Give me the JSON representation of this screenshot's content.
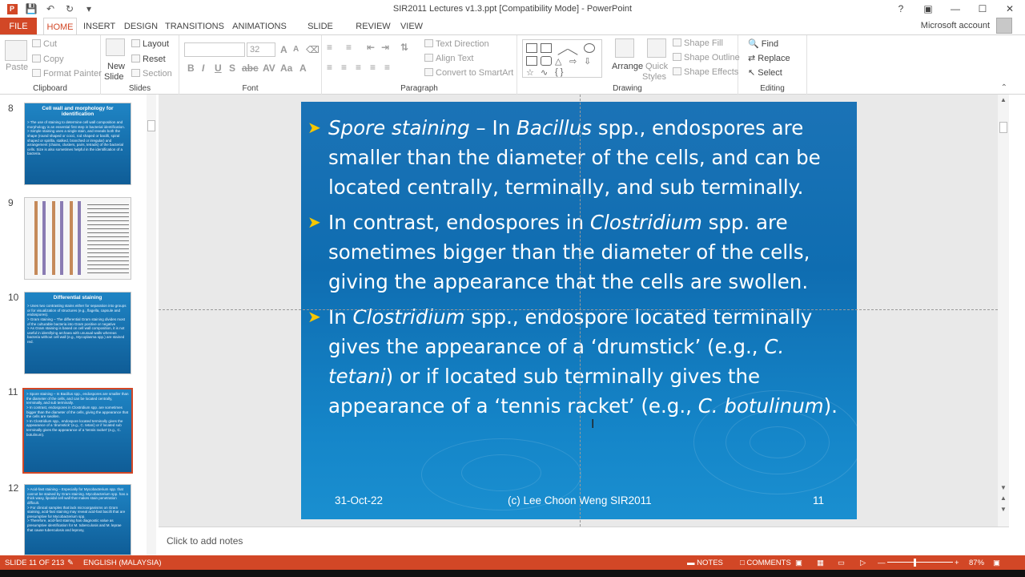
{
  "window": {
    "title": "SIR2011 Lectures v1.3.ppt [Compatibility Mode] - PowerPoint",
    "account": "Microsoft account"
  },
  "tabs": [
    "FILE",
    "HOME",
    "INSERT",
    "DESIGN",
    "TRANSITIONS",
    "ANIMATIONS",
    "SLIDE SHOW",
    "REVIEW",
    "VIEW"
  ],
  "ribbon": {
    "clipboard": {
      "paste": "Paste",
      "cut": "Cut",
      "copy": "Copy",
      "format_painter": "Format Painter",
      "label": "Clipboard"
    },
    "slides": {
      "new_slide": "New",
      "new_slide2": "Slide",
      "layout": "Layout",
      "reset": "Reset",
      "section": "Section",
      "label": "Slides"
    },
    "font": {
      "size": "32",
      "label": "Font"
    },
    "paragraph": {
      "text_direction": "Text Direction",
      "align_text": "Align Text",
      "smartart": "Convert to SmartArt",
      "label": "Paragraph"
    },
    "drawing": {
      "arrange": "Arrange",
      "quick_styles": "Quick",
      "quick_styles2": "Styles",
      "shape_fill": "Shape Fill",
      "shape_outline": "Shape Outline",
      "shape_effects": "Shape Effects",
      "label": "Drawing"
    },
    "editing": {
      "find": "Find",
      "replace": "Replace",
      "select": "Select",
      "label": "Editing"
    }
  },
  "thumbnails": [
    {
      "num": "8",
      "title": "Cell wall and morphology for identification",
      "body": "> The use of staining to determine cell wall composition and morphology is an essential first step in bacterial identification.\n> Simple staining uses a single stain, and reveals both the shape (round shaped or cocci, rod shaped or bacilli, spiral shaped or spirilla, stalked, branched or irregular) and arrangement (chains, clusters, pairs, tetrads) of the bacterial cells. Size is also sometimes helpful in the identification of a bacteria."
    },
    {
      "num": "9",
      "title": "",
      "body": ""
    },
    {
      "num": "10",
      "title": "Differential staining",
      "body": "> Uses two contrasting stains either for separation into groups or for visualization of structures (e.g., flagella, capsule and endospores).\n> Gram staining – The differential Gram staining divides most of the culturable bacteria into Gram positive or negative\n> As Gram staining is based on cell wall composition, it is not useful in identifying archaea with unusual walls whereas bacteria without cell wall (e.g., Mycoplasma spp.) are stained red."
    },
    {
      "num": "11",
      "title": "",
      "body": "> Spore staining – In Bacillus spp., endospores are smaller than the diameter of the cells, and can be located centrally, terminally, and sub terminally.\n> In contrast, endospores in Clostridium spp. are sometimes bigger than the diameter of the cells, giving the appearance that the cells are swollen.\n> In Clostridium spp., endospore located terminally gives the appearance of a 'drumstick' (e.g., C. tetani) or if located sub terminally gives the appearance of a 'tennis racket' (e.g., C. botulinum)."
    },
    {
      "num": "12",
      "title": "",
      "body": "> Acid-fast staining – Especially for Mycobacterium spp. that cannot be stained by Gram staining. Mycobacterium spp. has a thick waxy, lipoidal cell wall that makes stain penetration difficult.\n> For clinical samples that lack microorganisms on Gram staining, acid-fast staining may reveal acid-fast bacilli that are presumptive for Mycobacterium spp.\n> Therefore, acid-fast staining has diagnostic value as presumptive identification for M. tuberculosis and M. leprae that cause tuberculosis and leprosy,"
    }
  ],
  "slide": {
    "b1_i": "Spore staining",
    "b1_a": " – In ",
    "b1_b": "Bacillus",
    "b1_c": " spp., endospores are smaller than the diameter of the cells, and can be located centrally, terminally, and sub terminally.",
    "b2_a": "In contrast, endospores in ",
    "b2_b": "Clostridium",
    "b2_c": " spp. are sometimes bigger than the diameter of the cells, giving the appearance that the cells are swollen.",
    "b3_a": "In ",
    "b3_b": "Clostridium",
    "b3_c": " spp., endospore located terminally gives the appearance of a ‘drumstick’ (e.g., ",
    "b3_d": "C. tetani",
    "b3_e": ") or if located sub terminally gives the appearance of a ‘tennis racket’ (e.g., ",
    "b3_f": "C. botulinum",
    "b3_g": ").",
    "date": "31-Oct-22",
    "footer": "(c) Lee Choon Weng SIR2011",
    "slide_no": "11"
  },
  "notes_placeholder": "Click to add notes",
  "status": {
    "slide": "SLIDE 11 OF 213",
    "language": "ENGLISH (MALAYSIA)",
    "notes": "NOTES",
    "comments": "COMMENTS",
    "zoom": "87%"
  }
}
